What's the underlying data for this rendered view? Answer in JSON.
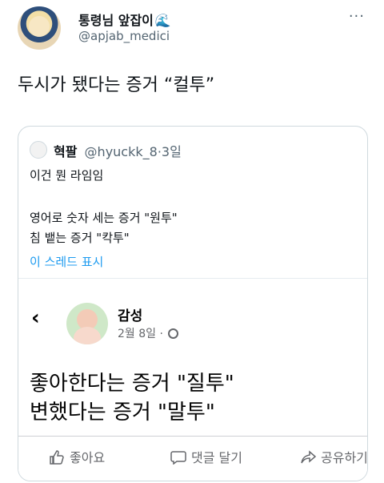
{
  "tweet": {
    "display_name": "통령님 앞잡이",
    "display_name_emoji": "🌊",
    "handle": "@apjab_medici",
    "more_icon": "more-horizontal-icon",
    "text": "두시가 됐다는 증거 “컬투”"
  },
  "quoted": {
    "name": "혁팔",
    "handle": "@hyuckk_8",
    "separator": "·",
    "time": "3일",
    "lines": [
      "이건 뭔 라임임",
      "영어로 숫자 세는 증거 \"원투\"",
      "침 뱉는 증거 \"칵투\""
    ],
    "thread_link": "이 스레드 표시"
  },
  "facebook_post": {
    "back_icon": "chevron-left-icon",
    "name": "감성",
    "date": "2월 8일 ·",
    "privacy_icon": "globe-icon",
    "lines": [
      "좋아한다는 증거 \"질투\"",
      "변했다는 증거 \"말투\""
    ],
    "actions": {
      "like": "좋아요",
      "comment": "댓글 달기",
      "share": "공유하기"
    }
  }
}
